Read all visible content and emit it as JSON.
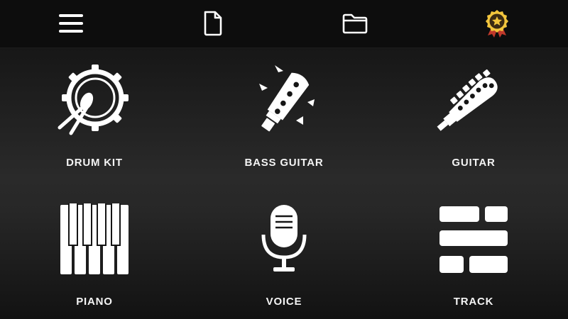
{
  "topbar": {
    "menu_icon": "hamburger-menu-icon",
    "new_icon": "new-file-icon",
    "open_icon": "folder-icon",
    "premium_icon": "award-badge-icon",
    "accent": "#f2c53d",
    "badge_ribbon": "#c0392b"
  },
  "instruments": [
    {
      "label": "DRUM KIT",
      "icon": "drum-kit-icon"
    },
    {
      "label": "BASS GUITAR",
      "icon": "bass-guitar-icon"
    },
    {
      "label": "GUITAR",
      "icon": "guitar-icon"
    },
    {
      "label": "PIANO",
      "icon": "piano-icon"
    },
    {
      "label": "VOICE",
      "icon": "microphone-icon"
    },
    {
      "label": "TRACK",
      "icon": "track-icon"
    }
  ]
}
